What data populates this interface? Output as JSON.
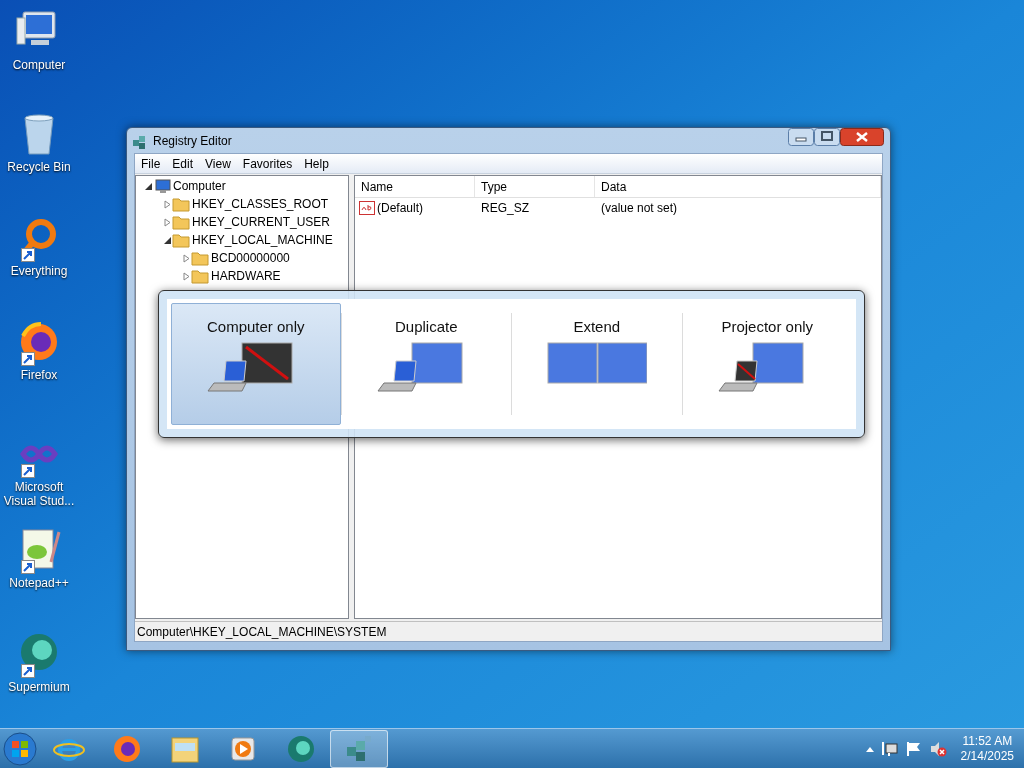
{
  "desktop_icons": [
    {
      "label": "Computer",
      "kind": "computer",
      "shortcut": false
    },
    {
      "label": "Recycle Bin",
      "kind": "recycle",
      "shortcut": false
    },
    {
      "label": "Everything",
      "kind": "everything",
      "shortcut": true
    },
    {
      "label": "Firefox",
      "kind": "firefox",
      "shortcut": true
    },
    {
      "label": "Microsoft Visual Stud...",
      "kind": "vs",
      "shortcut": true
    },
    {
      "label": "Notepad++",
      "kind": "notepad",
      "shortcut": true
    },
    {
      "label": "Supermium",
      "kind": "supermium",
      "shortcut": true
    }
  ],
  "window": {
    "title": "Registry Editor",
    "menu": [
      "File",
      "Edit",
      "View",
      "Favorites",
      "Help"
    ],
    "tree": [
      {
        "label": "Computer",
        "kind": "computer",
        "expanded": true,
        "children": [
          {
            "label": "HKEY_CLASSES_ROOT",
            "kind": "folder",
            "expanded": false
          },
          {
            "label": "HKEY_CURRENT_USER",
            "kind": "folder",
            "expanded": false
          },
          {
            "label": "HKEY_LOCAL_MACHINE",
            "kind": "folder",
            "expanded": true,
            "children": [
              {
                "label": "BCD00000000",
                "kind": "folder",
                "expanded": false
              },
              {
                "label": "HARDWARE",
                "kind": "folder",
                "expanded": false
              }
            ]
          }
        ]
      }
    ],
    "columns": [
      "Name",
      "Type",
      "Data"
    ],
    "rows": [
      {
        "name": "(Default)",
        "type": "REG_SZ",
        "data": "(value not set)"
      }
    ],
    "status_bar": "Computer\\HKEY_LOCAL_MACHINE\\SYSTEM"
  },
  "projection_switcher": [
    {
      "label": "Computer only",
      "kind": "computer_only",
      "selected": true
    },
    {
      "label": "Duplicate",
      "kind": "duplicate",
      "selected": false
    },
    {
      "label": "Extend",
      "kind": "extend",
      "selected": false
    },
    {
      "label": "Projector only",
      "kind": "projector_only",
      "selected": false
    }
  ],
  "taskbar": {
    "apps": [
      {
        "kind": "ie",
        "selected": false
      },
      {
        "kind": "firefox",
        "selected": false
      },
      {
        "kind": "explorer",
        "selected": false
      },
      {
        "kind": "media",
        "selected": false
      },
      {
        "kind": "supermium",
        "selected": false
      },
      {
        "kind": "regedit",
        "selected": true
      }
    ],
    "clock": {
      "time": "11:52 AM",
      "date": "2/14/2025"
    }
  }
}
